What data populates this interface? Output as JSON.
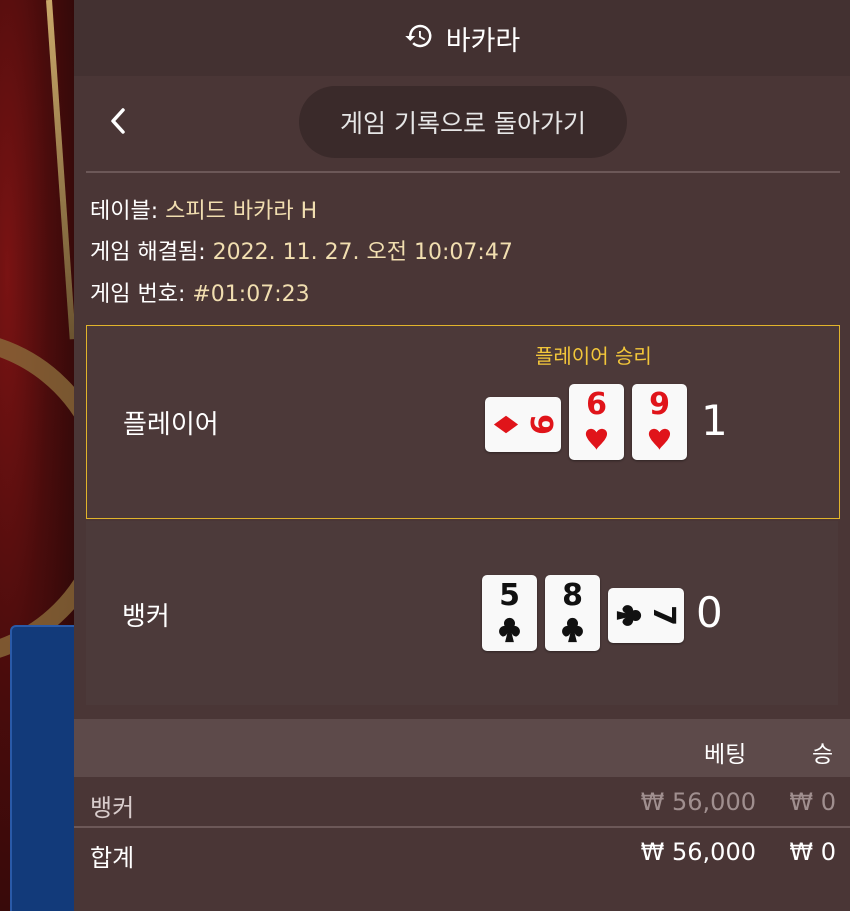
{
  "header": {
    "title": "바카라",
    "icon": "history-icon"
  },
  "nav": {
    "back_label": "게임 기록으로 돌아가기"
  },
  "info": {
    "table_label": "테이블:",
    "table_value": "스피드 바카라 H",
    "resolved_label": "게임 해결됨:",
    "resolved_value": "2022. 11. 27. 오전 10:07:47",
    "game_no_label": "게임 번호:",
    "game_no_value": "#01:07:23"
  },
  "player": {
    "label": "플레이어",
    "result": "플레이어 승리",
    "score": "1",
    "cards": [
      {
        "rank": "9",
        "suit": "diamond",
        "sideways": true
      },
      {
        "rank": "6",
        "suit": "heart",
        "sideways": false
      },
      {
        "rank": "9",
        "suit": "heart",
        "sideways": false
      }
    ]
  },
  "banker": {
    "label": "뱅커",
    "score": "0",
    "cards": [
      {
        "rank": "5",
        "suit": "club",
        "sideways": false
      },
      {
        "rank": "8",
        "suit": "club",
        "sideways": false
      },
      {
        "rank": "7",
        "suit": "club",
        "sideways": true
      }
    ]
  },
  "bets": {
    "col_bet": "베팅",
    "col_win": "승",
    "rows": [
      {
        "name": "뱅커",
        "bet": "₩ 56,000",
        "win": "₩ 0"
      }
    ],
    "total": {
      "name": "합계",
      "bet": "₩ 56,000",
      "win": "₩ 0"
    }
  },
  "colors": {
    "accent": "#e1b42b",
    "red_suit": "#e0141a",
    "black_suit": "#111111"
  }
}
